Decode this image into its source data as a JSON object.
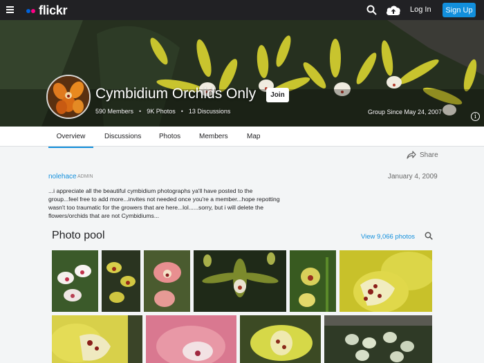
{
  "header": {
    "logo_text": "flickr",
    "logo_colors": [
      "#0063dc",
      "#ff0084"
    ],
    "login_label": "Log In",
    "signup_label": "Sign Up",
    "icons": [
      "menu-icon",
      "search-icon",
      "upload-cloud-icon"
    ]
  },
  "group": {
    "title": "Cymbidium Orchids Only",
    "join_label": "Join",
    "members": "590 Members",
    "photos": "9K Photos",
    "discussions": "13 Discussions",
    "since": "Group Since May 24, 2007"
  },
  "tabs": [
    {
      "label": "Overview",
      "active": true
    },
    {
      "label": "Discussions"
    },
    {
      "label": "Photos"
    },
    {
      "label": "Members"
    },
    {
      "label": "Map"
    }
  ],
  "post": {
    "share_label": "Share",
    "author": "nolehace",
    "role": "ADMIN",
    "date": "January 4, 2009",
    "text": "...i appreciate all the beautiful cymbidium photographs ya'll have posted to the group...feel free to add more...invites not needed once you're a member...hope repotting wasn't too traumatic for the growers that are here...lol......sorry, but i will delete the flowers/orchids that are not Cymbidiums..."
  },
  "pool": {
    "title": "Photo pool",
    "view_label": "View 9,066 photos"
  },
  "accent": "#128fdc"
}
